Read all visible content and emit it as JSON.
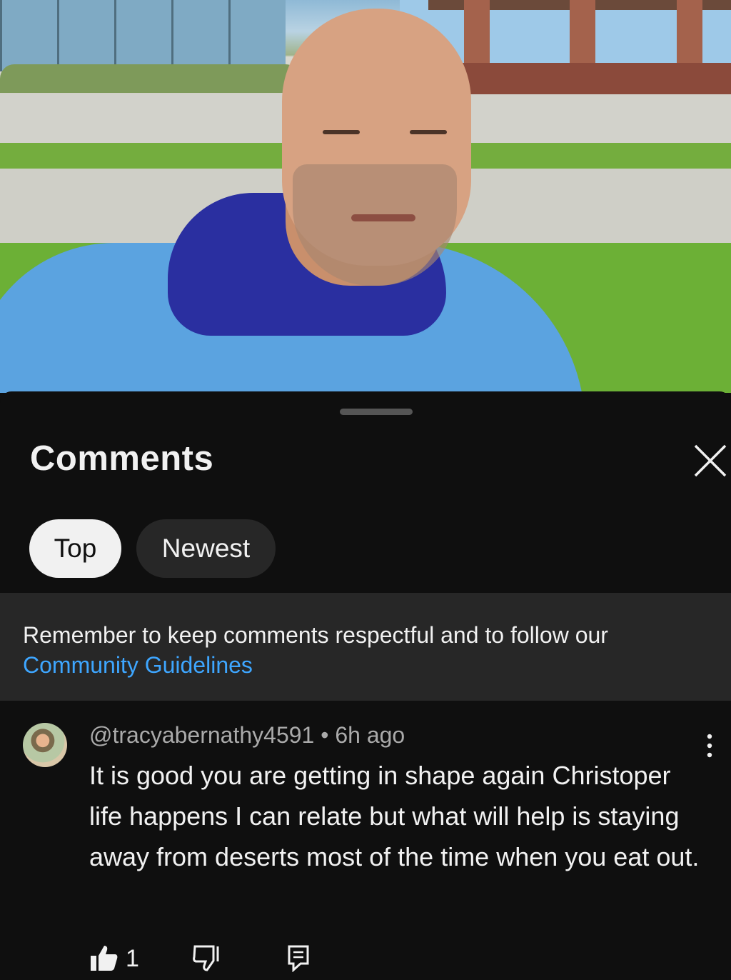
{
  "video": {
    "description_icon": "video-frame"
  },
  "sheet": {
    "title": "Comments",
    "close_icon": "close-icon",
    "sort_chips": [
      {
        "label": "Top",
        "selected": true
      },
      {
        "label": "Newest",
        "selected": false
      }
    ],
    "notice": {
      "text": "Remember to keep comments respectful and to follow our ",
      "link": "Community Guidelines"
    }
  },
  "comment": {
    "author": "@tracyabernathy4591",
    "separator": " • ",
    "time": "6h ago",
    "text": "It is good you are getting in shape again Christoper life happens I can relate but what will help is staying away from deserts most of the time when you eat out.",
    "likes": "1",
    "icons": [
      "thumbs-up-icon",
      "thumbs-down-icon",
      "reply-icon",
      "more-vert-icon"
    ]
  },
  "colors": {
    "background": "#0f0f0f",
    "notice_background": "#272727",
    "link": "#3ea6ff",
    "chip_selected": "#f1f1f1",
    "chip_unselected": "#272727",
    "secondary_text": "#aaaaaa"
  }
}
